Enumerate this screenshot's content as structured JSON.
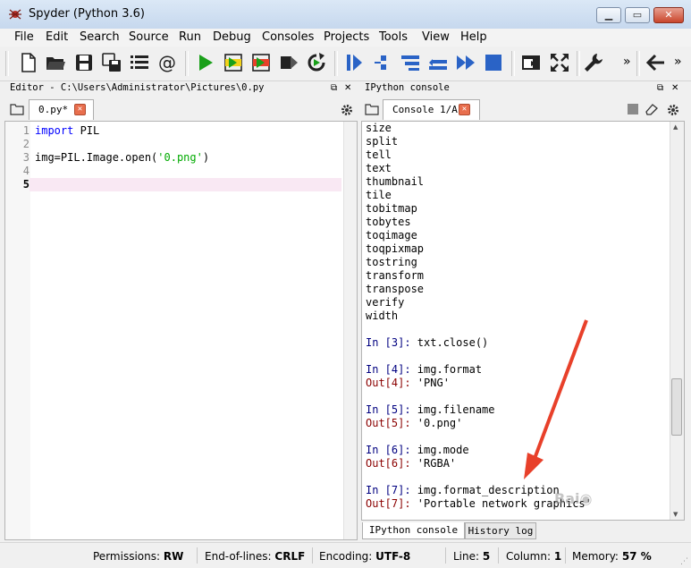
{
  "window": {
    "title": "Spyder (Python 3.6)"
  },
  "menu": [
    "File",
    "Edit",
    "Search",
    "Source",
    "Run",
    "Debug",
    "Consoles",
    "Projects",
    "Tools",
    "View",
    "Help"
  ],
  "toolbar": {
    "overflow1": "»",
    "overflow2": "»"
  },
  "editor": {
    "pane_title": "Editor - C:\\Users\\Administrator\\Pictures\\0.py",
    "tab_label": "0.py*",
    "lines": [
      {
        "n": "1",
        "kw": "import",
        "rest": " PIL"
      },
      {
        "n": "2",
        "text": ""
      },
      {
        "n": "3",
        "pre": "img=PIL.Image.open(",
        "str": "'0.png'",
        "post": ")"
      },
      {
        "n": "4",
        "text": ""
      },
      {
        "n": "5",
        "text": ""
      }
    ]
  },
  "console": {
    "pane_title": "IPython console",
    "tab_label": "Console 1/A",
    "lines": [
      "size",
      "split",
      "tell",
      "text",
      "thumbnail",
      "tile",
      "tobitmap",
      "tobytes",
      "toqimage",
      "toqpixmap",
      "tostring",
      "transform",
      "transpose",
      "verify",
      "width"
    ],
    "history": [
      {
        "in_prompt": "In [3]:",
        "in_code": " txt.close()"
      },
      {
        "in_prompt": "In [4]:",
        "in_code": " img.format",
        "out_prompt": "Out[4]:",
        "out_val": " 'PNG'"
      },
      {
        "in_prompt": "In [5]:",
        "in_code": " img.filename",
        "out_prompt": "Out[5]:",
        "out_val": " '0.png'"
      },
      {
        "in_prompt": "In [6]:",
        "in_code": " img.mode",
        "out_prompt": "Out[6]:",
        "out_val": " 'RGBA'"
      },
      {
        "in_prompt": "In [7]:",
        "in_code": " img.format_description",
        "out_prompt": "Out[7]:",
        "out_val": " 'Portable network graphics'"
      }
    ],
    "bottom_tabs": [
      "IPython console",
      "History log"
    ]
  },
  "status": {
    "permissions_label": "Permissions:",
    "permissions_value": "RW",
    "eol_label": "End-of-lines:",
    "eol_value": "CRLF",
    "encoding_label": "Encoding:",
    "encoding_value": "UTF-8",
    "line_label": "Line:",
    "line_value": "5",
    "column_label": "Column:",
    "column_value": "1",
    "memory_label": "Memory:",
    "memory_value": "57 %"
  },
  "colors": {
    "accent_red": "#e8402a",
    "run_green": "#1aa01a",
    "toolbar_blue": "#2a63c6"
  }
}
